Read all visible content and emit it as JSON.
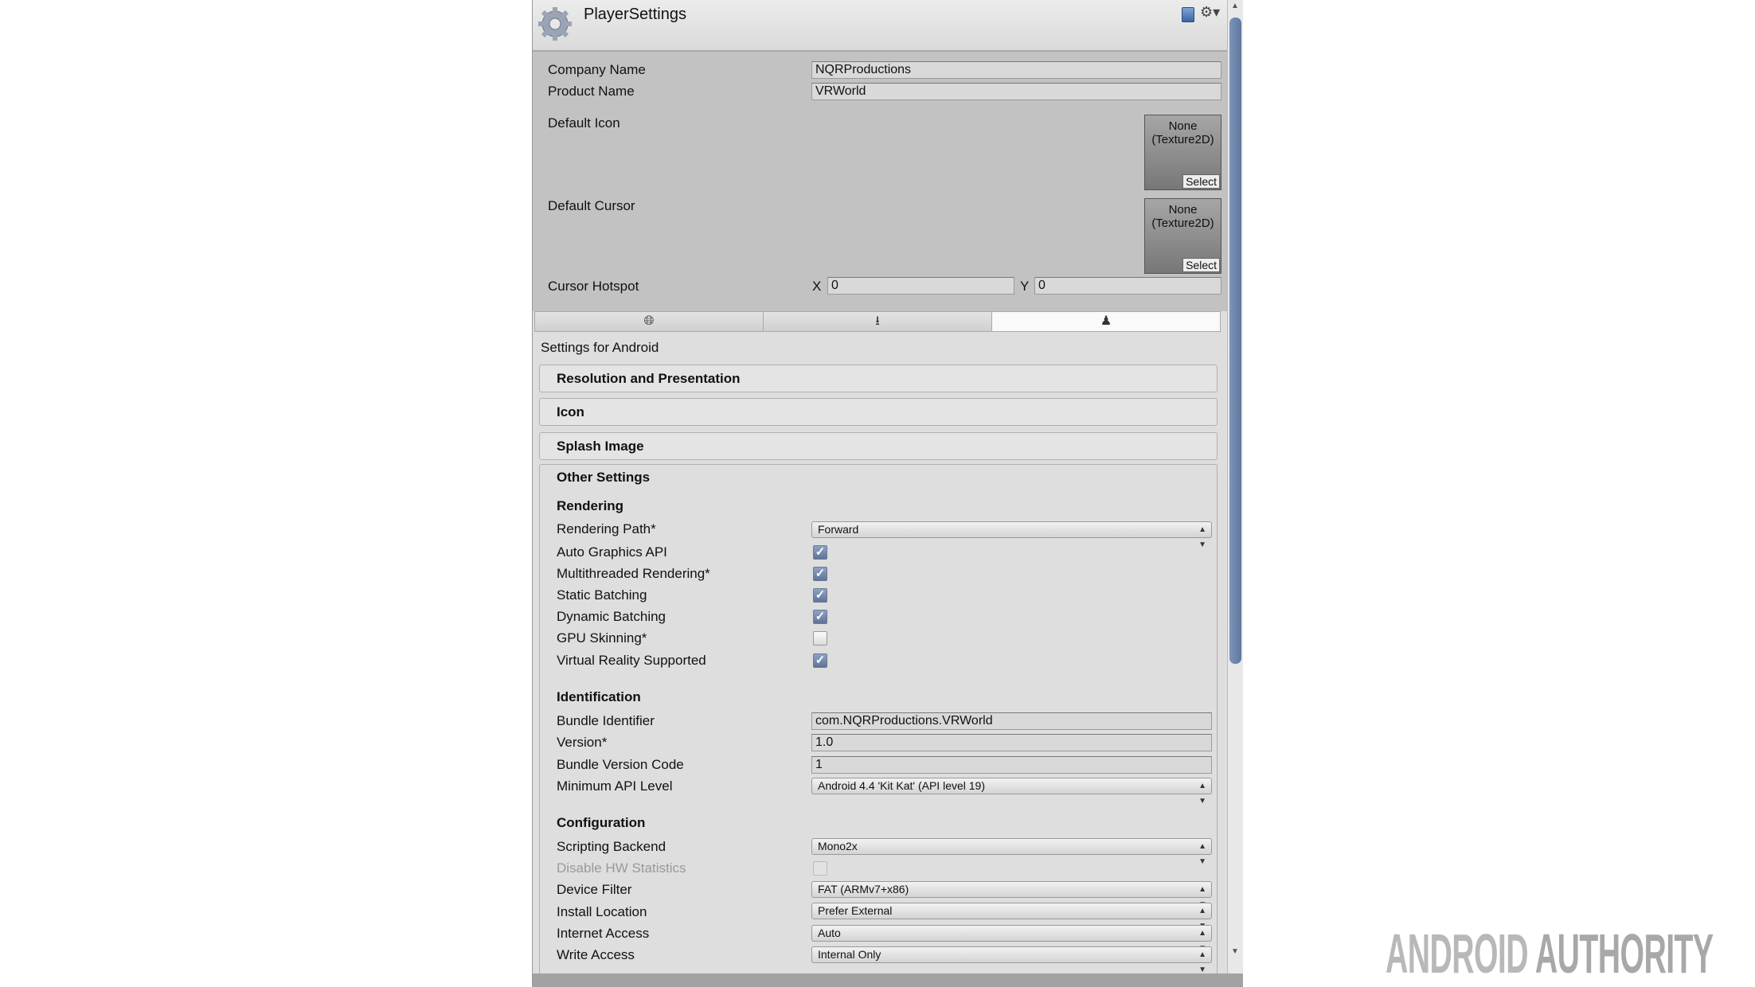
{
  "header": {
    "title": "PlayerSettings",
    "icons": [
      "gear-icon",
      "help-book-icon",
      "settings-cog-icon"
    ]
  },
  "general": {
    "company_name": {
      "label": "Company Name",
      "value": "NQRProductions"
    },
    "product_name": {
      "label": "Product Name",
      "value": "VRWorld"
    },
    "default_icon": {
      "label": "Default Icon",
      "line1": "None",
      "line2": "(Texture2D)",
      "select": "Select"
    },
    "default_cursor": {
      "label": "Default Cursor",
      "line1": "None",
      "line2": "(Texture2D)",
      "select": "Select"
    },
    "cursor_hotspot": {
      "label": "Cursor Hotspot",
      "x_label": "X",
      "x": "0",
      "y_label": "Y",
      "y": "0"
    }
  },
  "platform_tabs": [
    {
      "icon": "globe-icon",
      "selected": false
    },
    {
      "icon": "download-icon",
      "selected": false
    },
    {
      "icon": "android-icon",
      "selected": true
    }
  ],
  "settings_for": "Settings for Android",
  "sections": [
    "Resolution and Presentation",
    "Icon",
    "Splash Image"
  ],
  "other": {
    "title": "Other Settings",
    "rendering": {
      "title": "Rendering",
      "rendering_path": {
        "label": "Rendering Path*",
        "value": "Forward"
      },
      "checks": [
        {
          "label": "Auto Graphics API",
          "checked": true
        },
        {
          "label": "Multithreaded Rendering*",
          "checked": true
        },
        {
          "label": "Static Batching",
          "checked": true
        },
        {
          "label": "Dynamic Batching",
          "checked": true
        },
        {
          "label": "GPU Skinning*",
          "checked": false
        },
        {
          "label": "Virtual Reality Supported",
          "checked": true
        }
      ]
    },
    "identification": {
      "title": "Identification",
      "bundle_identifier": {
        "label": "Bundle Identifier",
        "value": "com.NQRProductions.VRWorld"
      },
      "version": {
        "label": "Version*",
        "value": "1.0"
      },
      "bundle_version_code": {
        "label": "Bundle Version Code",
        "value": "1"
      },
      "min_api": {
        "label": "Minimum API Level",
        "value": "Android 4.4 'Kit Kat' (API level 19)"
      }
    },
    "configuration": {
      "title": "Configuration",
      "scripting_backend": {
        "label": "Scripting Backend",
        "value": "Mono2x"
      },
      "disable_hw": {
        "label": "Disable HW Statistics",
        "checked": false,
        "disabled": true
      },
      "device_filter": {
        "label": "Device Filter",
        "value": "FAT (ARMv7+x86)"
      },
      "install_location": {
        "label": "Install Location",
        "value": "Prefer External"
      },
      "internet_access": {
        "label": "Internet Access",
        "value": "Auto"
      },
      "write_access": {
        "label": "Write Access",
        "value": "Internal Only"
      }
    }
  },
  "watermark": "ANDROID AUTHORITY",
  "colors": {
    "checkbox": "#6f86ab",
    "panel": "#dedede",
    "top_section": "#c2c2c2"
  }
}
